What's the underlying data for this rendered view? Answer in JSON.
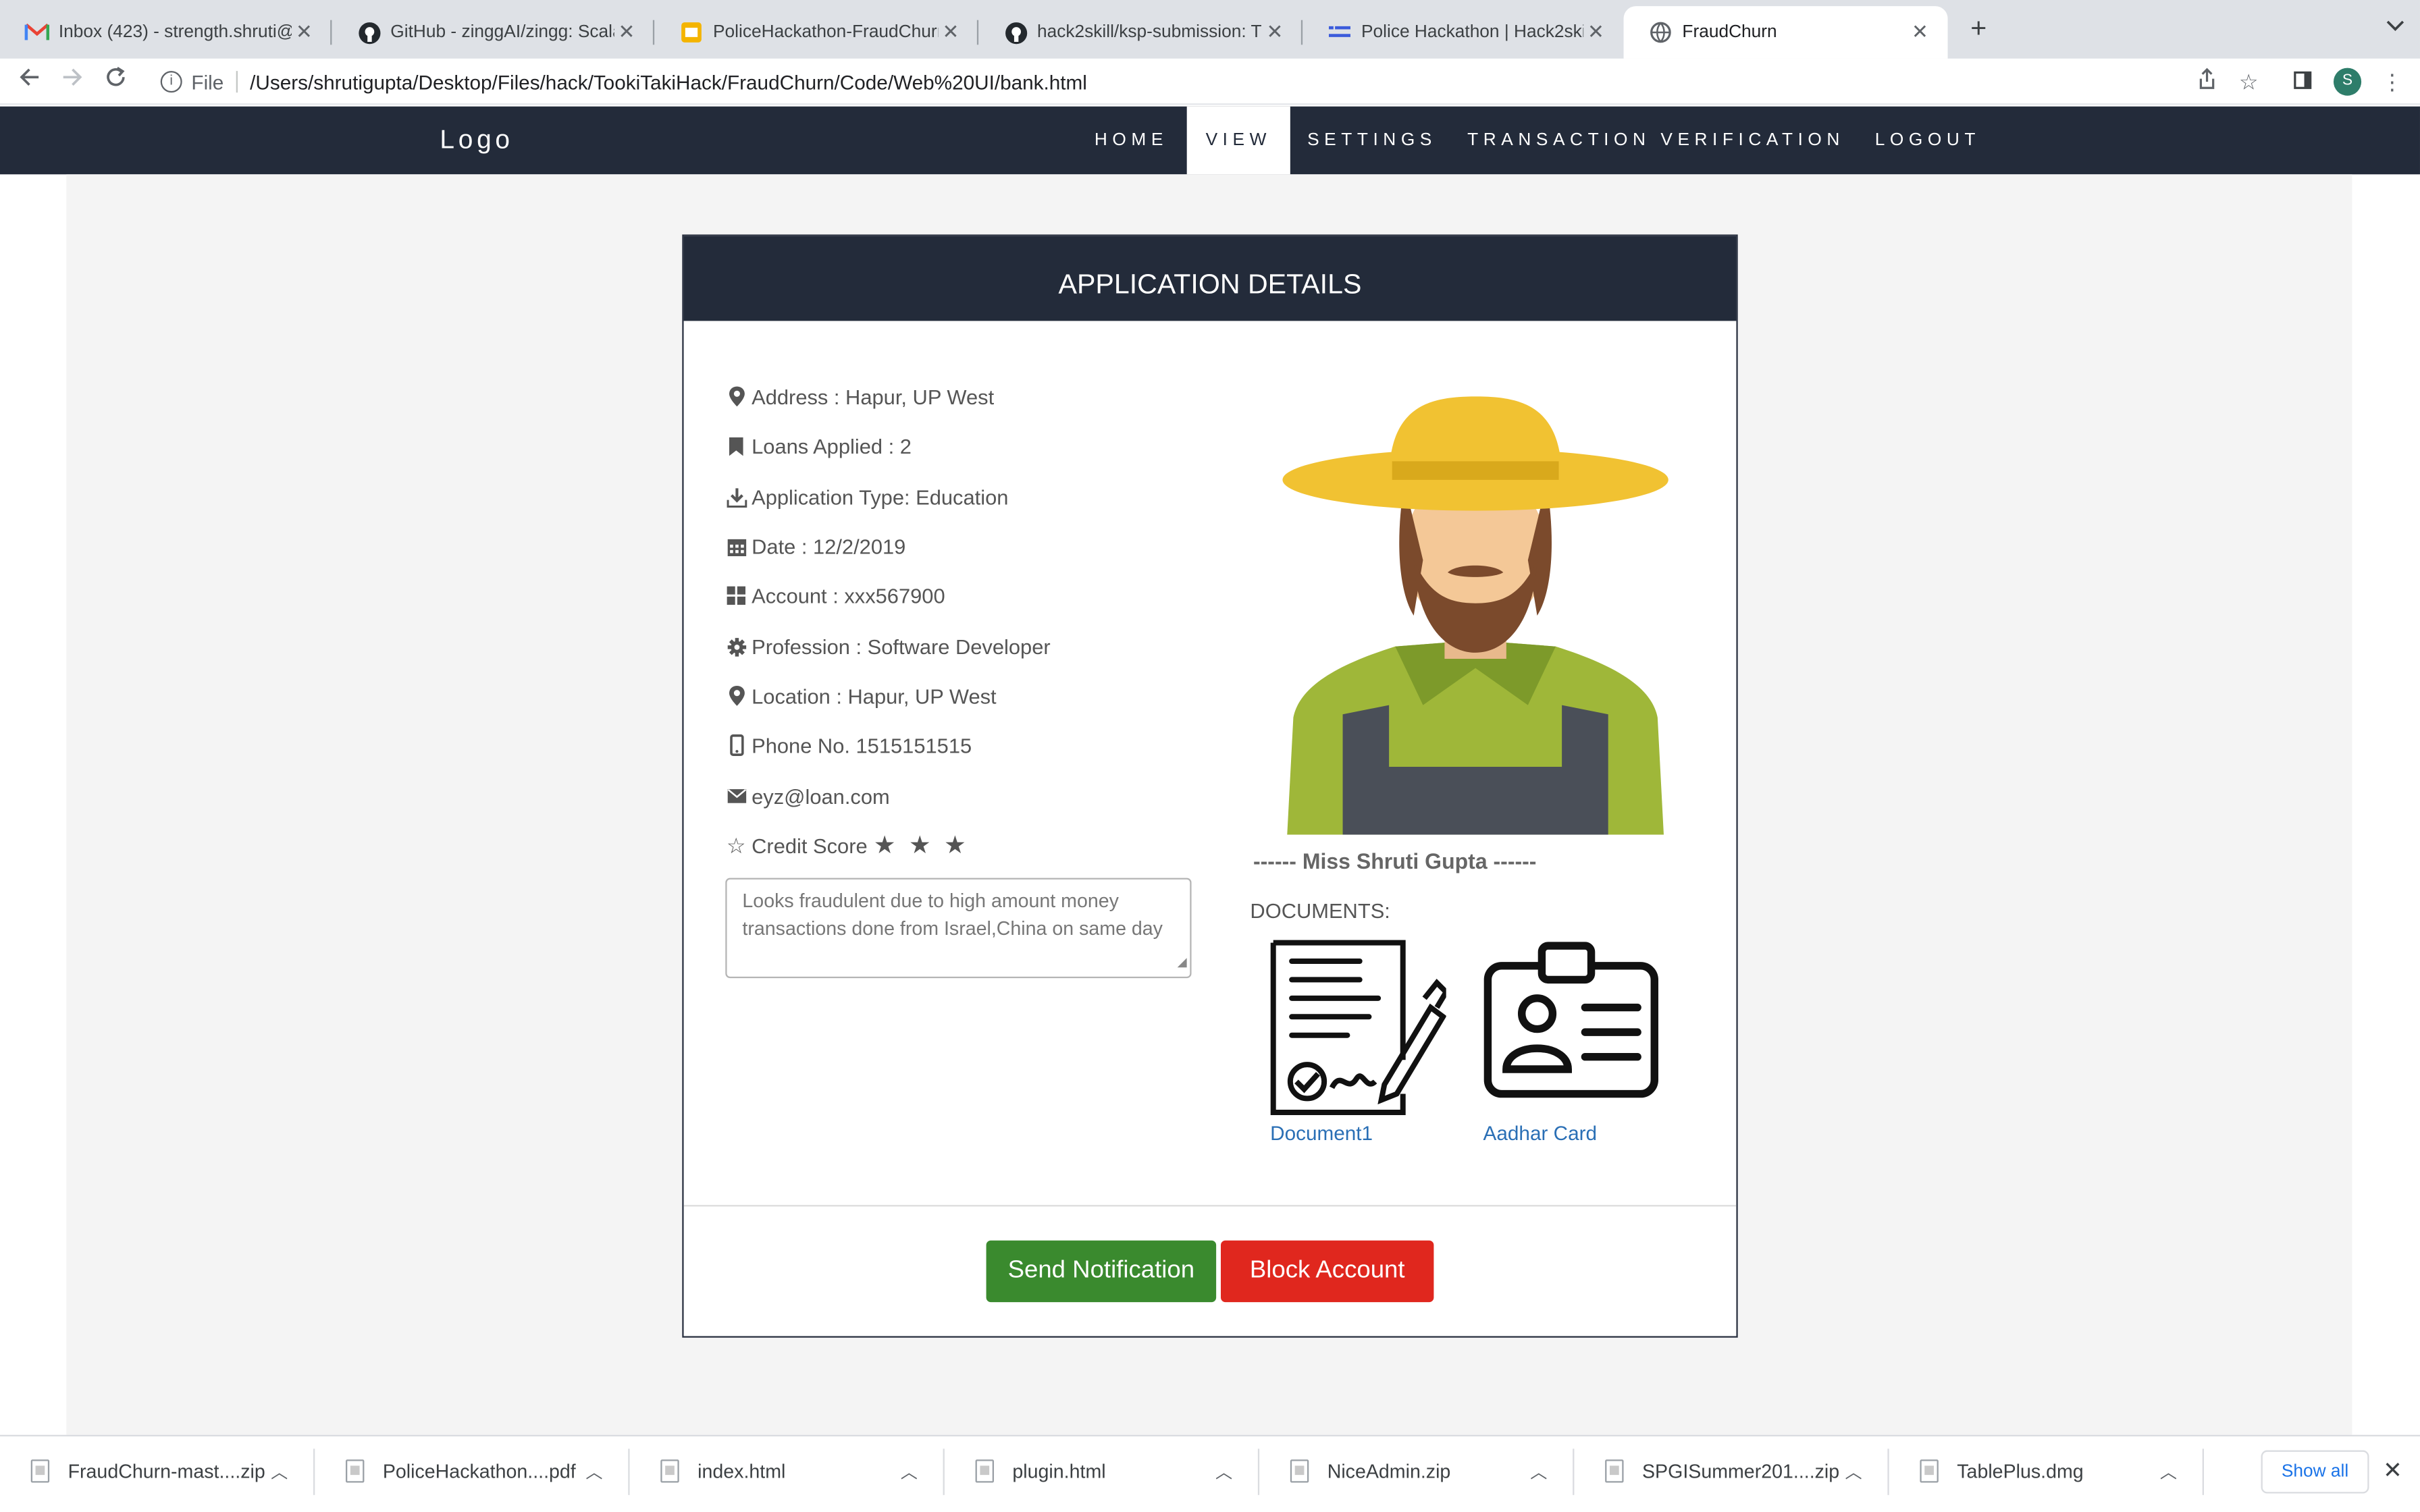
{
  "browser": {
    "tabs": [
      {
        "title": "Inbox (423) - strength.shruti@",
        "icon": "gmail-icon",
        "active": false
      },
      {
        "title": "GitHub - zinggAI/zingg: Scalab",
        "icon": "github-icon",
        "active": false
      },
      {
        "title": "PoliceHackathon-FraudChurn -",
        "icon": "slides-icon",
        "active": false
      },
      {
        "title": "hack2skill/ksp-submission: Thi",
        "icon": "github-icon",
        "active": false
      },
      {
        "title": "Police Hackathon | Hack2skill |",
        "icon": "hack2skill-icon",
        "active": false
      },
      {
        "title": "FraudChurn",
        "icon": "globe-icon",
        "active": true
      }
    ],
    "new_tab_label": "+",
    "omnibox": {
      "scheme": "File",
      "url": "/Users/shrutigupta/Desktop/Files/hack/TookiTakiHack/FraudChurn/Code/Web%20UI/bank.html"
    },
    "profile_initial": "S"
  },
  "navbar": {
    "logo": "Logo",
    "items": [
      {
        "label": "HOME",
        "active": false
      },
      {
        "label": "VIEW",
        "active": true
      },
      {
        "label": "SETTINGS",
        "active": false
      },
      {
        "label": "TRANSACTION VERIFICATION",
        "active": false
      },
      {
        "label": "LOGOUT",
        "active": false
      }
    ]
  },
  "application": {
    "heading": "APPLICATION DETAILS",
    "details": [
      {
        "icon": "map-pin-icon",
        "text": "Address : Hapur, UP West"
      },
      {
        "icon": "bookmark-icon",
        "text": "Loans Applied : 2"
      },
      {
        "icon": "download-icon",
        "text": "Application Type: Education"
      },
      {
        "icon": "calendar-icon",
        "text": "Date : 12/2/2019"
      },
      {
        "icon": "grid-icon",
        "text": "Account : xxx567900"
      },
      {
        "icon": "gear-icon",
        "text": "Profession : Software Developer"
      },
      {
        "icon": "map-pin-icon",
        "text": "Location : Hapur, UP West"
      },
      {
        "icon": "phone-icon",
        "text": "Phone No. 1515151515"
      },
      {
        "icon": "envelope-icon",
        "text": "eyz@loan.com"
      },
      {
        "icon": "star-outline-icon",
        "text": "Credit Score"
      }
    ],
    "credit_score_stars": 3,
    "credit_score_display": "★ ★ ★",
    "note": "Looks fraudulent due to high amount money transactions done from Israel,China on same day",
    "applicant_name": "------ Miss Shruti Gupta ------",
    "documents_label": "DOCUMENTS:",
    "documents": [
      {
        "label": "Document1",
        "icon": "signed-document-icon"
      },
      {
        "label": "Aadhar Card",
        "icon": "id-card-icon"
      }
    ],
    "actions": {
      "send_notification": "Send Notification",
      "block_account": "Block Account"
    },
    "colors": {
      "navbar": "#232b3a",
      "send": "#3a8a2e",
      "block": "#e0271e",
      "link": "#2a6fb5"
    }
  },
  "downloads": {
    "items": [
      {
        "name": "FraudChurn-mast....zip"
      },
      {
        "name": "PoliceHackathon....pdf"
      },
      {
        "name": "index.html"
      },
      {
        "name": "plugin.html"
      },
      {
        "name": "NiceAdmin.zip"
      },
      {
        "name": "SPGISummer201....zip"
      },
      {
        "name": "TablePlus.dmg"
      }
    ],
    "show_all": "Show all",
    "close": "✕"
  }
}
